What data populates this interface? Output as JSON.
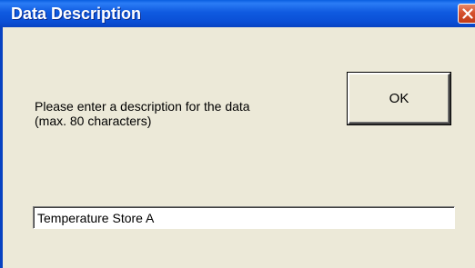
{
  "window": {
    "title": "Data Description",
    "close_icon": "close-icon"
  },
  "dialog": {
    "message_line1": "Please enter a description for the data",
    "message_line2": "(max. 80 characters)",
    "ok_label": "OK",
    "description_value": "Temperature Store A"
  },
  "colors": {
    "titlebar": "#0A4FD6",
    "close_button": "#D6512F",
    "background": "#ECE9D8"
  }
}
